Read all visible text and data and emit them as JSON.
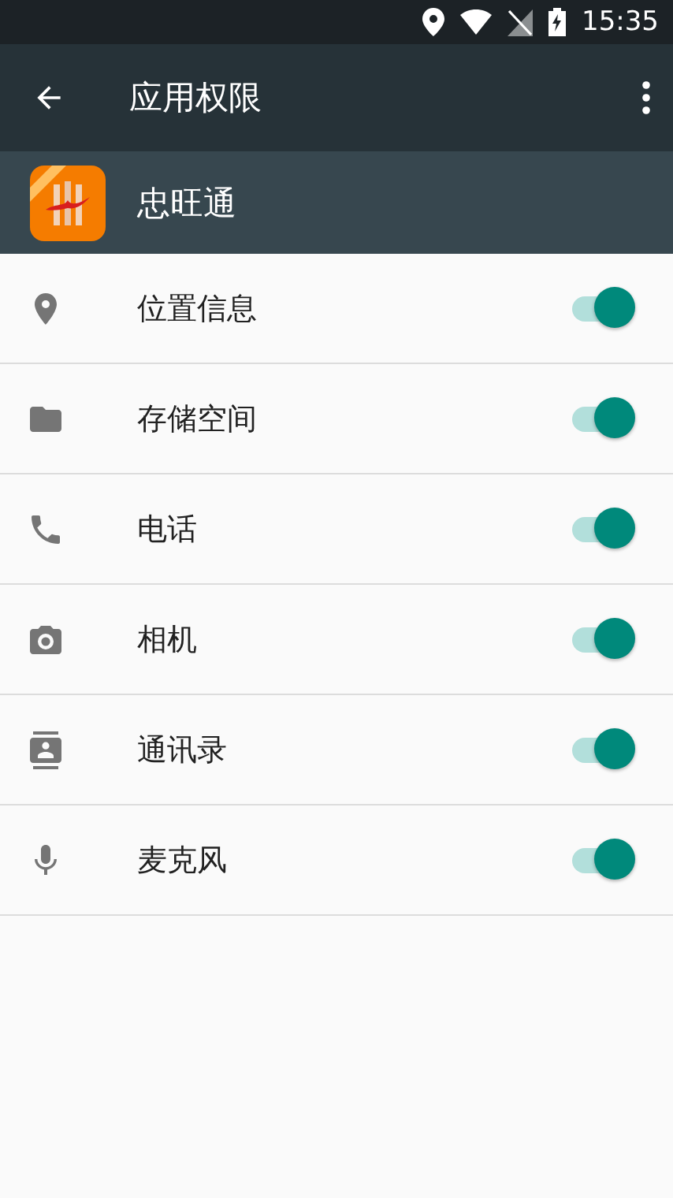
{
  "status_bar": {
    "time": "15:35"
  },
  "toolbar": {
    "title": "应用权限"
  },
  "app": {
    "name": "忠旺通"
  },
  "permissions": [
    {
      "kind": "location",
      "label": "位置信息",
      "on": true
    },
    {
      "kind": "storage",
      "label": "存储空间",
      "on": true
    },
    {
      "kind": "phone",
      "label": "电话",
      "on": true
    },
    {
      "kind": "camera",
      "label": "相机",
      "on": true
    },
    {
      "kind": "contacts",
      "label": "通讯录",
      "on": true
    },
    {
      "kind": "microphone",
      "label": "麦克风",
      "on": true
    }
  ]
}
